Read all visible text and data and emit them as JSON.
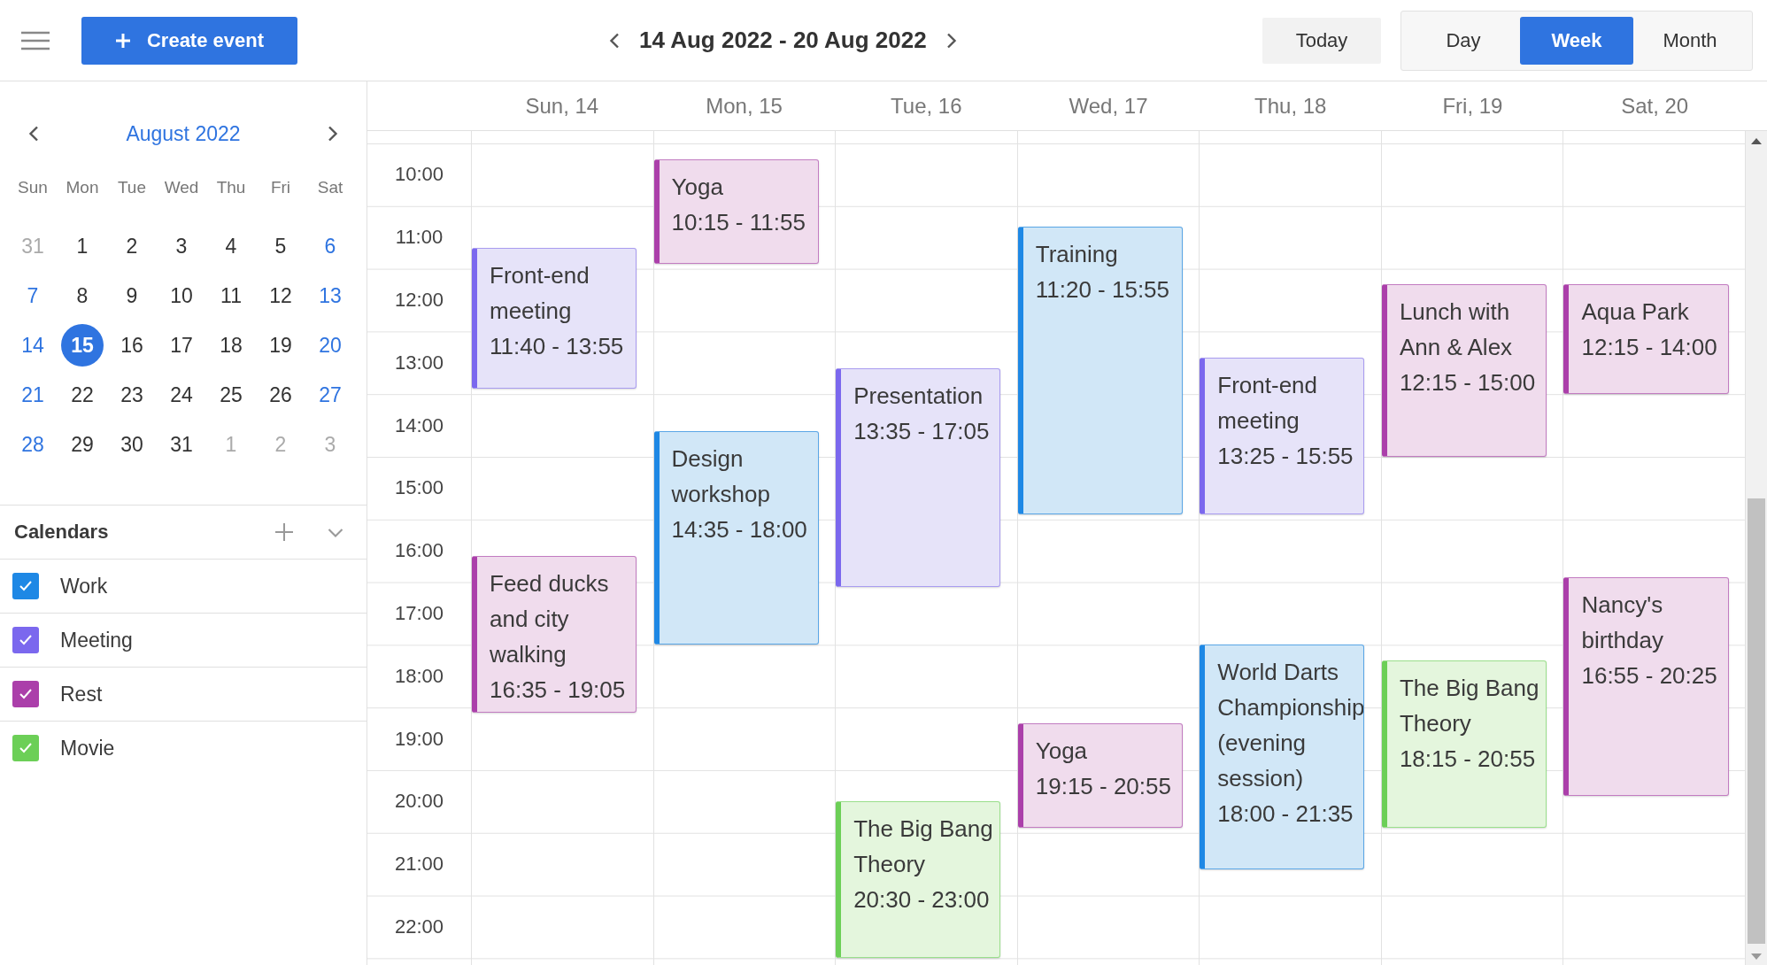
{
  "toolbar": {
    "create_button": "Create event",
    "date_range": "14 Aug 2022 - 20 Aug 2022",
    "today_button": "Today",
    "views": [
      {
        "label": "Day",
        "selected": false
      },
      {
        "label": "Week",
        "selected": true
      },
      {
        "label": "Month",
        "selected": false
      }
    ]
  },
  "mini_calendar": {
    "month": "August 2022",
    "weekdays": [
      "Sun",
      "Mon",
      "Tue",
      "Wed",
      "Thu",
      "Fri",
      "Sat"
    ],
    "weeks": [
      [
        {
          "day": "31",
          "other_month": true,
          "selected": false
        },
        {
          "day": "1",
          "other_month": false,
          "selected": false
        },
        {
          "day": "2",
          "other_month": false,
          "selected": false
        },
        {
          "day": "3",
          "other_month": false,
          "selected": false
        },
        {
          "day": "4",
          "other_month": false,
          "selected": false
        },
        {
          "day": "5",
          "other_month": false,
          "selected": false
        },
        {
          "day": "6",
          "other_month": false,
          "selected": false
        }
      ],
      [
        {
          "day": "7",
          "other_month": false,
          "selected": false
        },
        {
          "day": "8",
          "other_month": false,
          "selected": false
        },
        {
          "day": "9",
          "other_month": false,
          "selected": false
        },
        {
          "day": "10",
          "other_month": false,
          "selected": false
        },
        {
          "day": "11",
          "other_month": false,
          "selected": false
        },
        {
          "day": "12",
          "other_month": false,
          "selected": false
        },
        {
          "day": "13",
          "other_month": false,
          "selected": false
        }
      ],
      [
        {
          "day": "14",
          "other_month": false,
          "selected": false
        },
        {
          "day": "15",
          "other_month": false,
          "selected": true
        },
        {
          "day": "16",
          "other_month": false,
          "selected": false
        },
        {
          "day": "17",
          "other_month": false,
          "selected": false
        },
        {
          "day": "18",
          "other_month": false,
          "selected": false
        },
        {
          "day": "19",
          "other_month": false,
          "selected": false
        },
        {
          "day": "20",
          "other_month": false,
          "selected": false
        }
      ],
      [
        {
          "day": "21",
          "other_month": false,
          "selected": false
        },
        {
          "day": "22",
          "other_month": false,
          "selected": false
        },
        {
          "day": "23",
          "other_month": false,
          "selected": false
        },
        {
          "day": "24",
          "other_month": false,
          "selected": false
        },
        {
          "day": "25",
          "other_month": false,
          "selected": false
        },
        {
          "day": "26",
          "other_month": false,
          "selected": false
        },
        {
          "day": "27",
          "other_month": false,
          "selected": false
        }
      ],
      [
        {
          "day": "28",
          "other_month": false,
          "selected": false
        },
        {
          "day": "29",
          "other_month": false,
          "selected": false
        },
        {
          "day": "30",
          "other_month": false,
          "selected": false
        },
        {
          "day": "31",
          "other_month": false,
          "selected": false
        },
        {
          "day": "1",
          "other_month": true,
          "selected": false
        },
        {
          "day": "2",
          "other_month": true,
          "selected": false
        },
        {
          "day": "3",
          "other_month": true,
          "selected": false
        }
      ]
    ]
  },
  "calendars": {
    "title": "Calendars",
    "items": [
      {
        "label": "Work",
        "checked": true,
        "color": "#1e88e5"
      },
      {
        "label": "Meeting",
        "checked": true,
        "color": "#7b68ee"
      },
      {
        "label": "Rest",
        "checked": true,
        "color": "#ab3faa"
      },
      {
        "label": "Movie",
        "checked": true,
        "color": "#6ccf57"
      }
    ]
  },
  "hours": [
    "10:00",
    "11:00",
    "12:00",
    "13:00",
    "14:00",
    "15:00",
    "16:00",
    "17:00",
    "18:00",
    "19:00",
    "20:00",
    "21:00",
    "22:00"
  ],
  "days": [
    {
      "label": "Sun, 14",
      "events": [
        {
          "title": "Front-end meeting",
          "time": "11:40 - 13:55",
          "kind": "meeting"
        },
        {
          "title": "Feed ducks and city walking",
          "time": "16:35 - 19:05",
          "kind": "rest"
        }
      ]
    },
    {
      "label": "Mon, 15",
      "events": [
        {
          "title": "Yoga",
          "time": "10:15 - 11:55",
          "kind": "rest"
        },
        {
          "title": "Design workshop",
          "time": "14:35 - 18:00",
          "kind": "work"
        }
      ]
    },
    {
      "label": "Tue, 16",
      "events": [
        {
          "title": "Presentation",
          "time": "13:35 - 17:05",
          "kind": "meeting"
        },
        {
          "title": "The Big Bang Theory",
          "time": "20:30 - 23:00",
          "kind": "movie"
        }
      ]
    },
    {
      "label": "Wed, 17",
      "events": [
        {
          "title": "Training",
          "time": "11:20 - 15:55",
          "kind": "work"
        },
        {
          "title": "Yoga",
          "time": "19:15 - 20:55",
          "kind": "rest"
        }
      ]
    },
    {
      "label": "Thu, 18",
      "events": [
        {
          "title": "Front-end meeting",
          "time": "13:25 - 15:55",
          "kind": "meeting"
        },
        {
          "title": "World Darts Championship (evening session)",
          "time": "18:00 - 21:35",
          "kind": "work"
        }
      ]
    },
    {
      "label": "Fri, 19",
      "events": [
        {
          "title": "Lunch with Ann & Alex",
          "time": "12:15 - 15:00",
          "kind": "rest"
        },
        {
          "title": "The Big Bang Theory",
          "time": "18:15 - 20:55",
          "kind": "movie"
        }
      ]
    },
    {
      "label": "Sat, 20",
      "events": [
        {
          "title": "Aqua Park",
          "time": "12:15 - 14:00",
          "kind": "rest"
        },
        {
          "title": "Nancy's birthday",
          "time": "16:55 - 20:25",
          "kind": "rest"
        }
      ]
    }
  ]
}
